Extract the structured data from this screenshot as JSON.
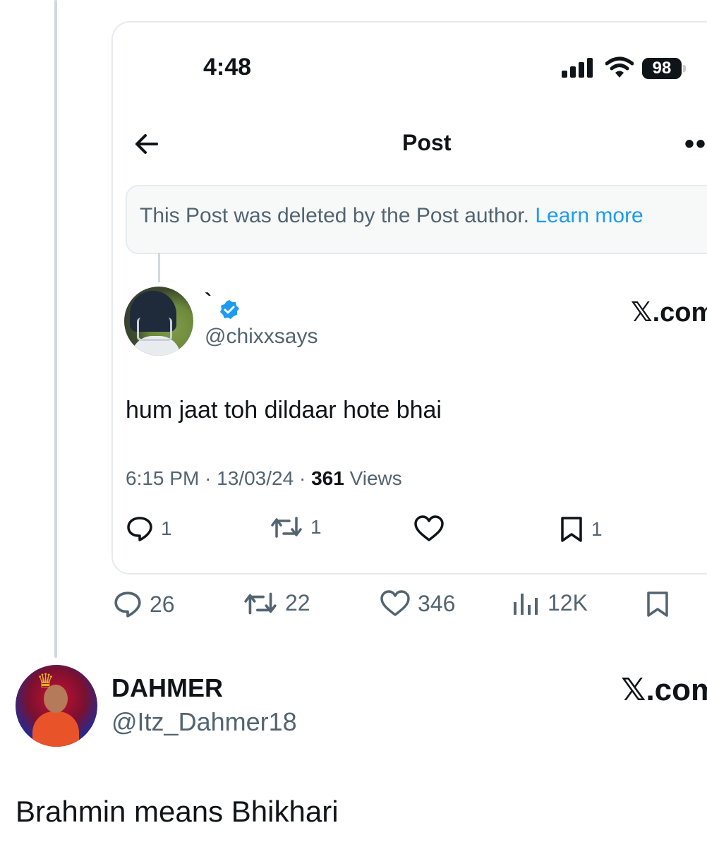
{
  "quoted_screenshot": {
    "status_bar": {
      "time": "4:48",
      "battery": "98"
    },
    "nav": {
      "title": "Post"
    },
    "deleted_notice": {
      "text": "This Post was deleted by the Post author.",
      "link": "Learn more"
    },
    "quoted_post": {
      "display_name": "`",
      "handle": "@chixxsays",
      "source_logo": "𝕏.com",
      "body": "hum jaat toh dildaar hote bhai",
      "time": "6:15 PM",
      "date": "13/03/24",
      "views_count": "361",
      "views_label": "Views",
      "actions": {
        "replies": "1",
        "reposts": "1",
        "bookmarks": "1"
      }
    }
  },
  "outer_post_actions": {
    "replies": "26",
    "reposts": "22",
    "likes": "346",
    "views": "12K"
  },
  "reply_post": {
    "display_name": "DAHMER",
    "handle": "@Itz_Dahmer18",
    "source_logo": "𝕏.com",
    "body": "Brahmin means Bhikhari"
  },
  "colors": {
    "accent": "#1d9bf0",
    "muted": "#536471",
    "text": "#0f1419",
    "line": "#cfd9de"
  }
}
